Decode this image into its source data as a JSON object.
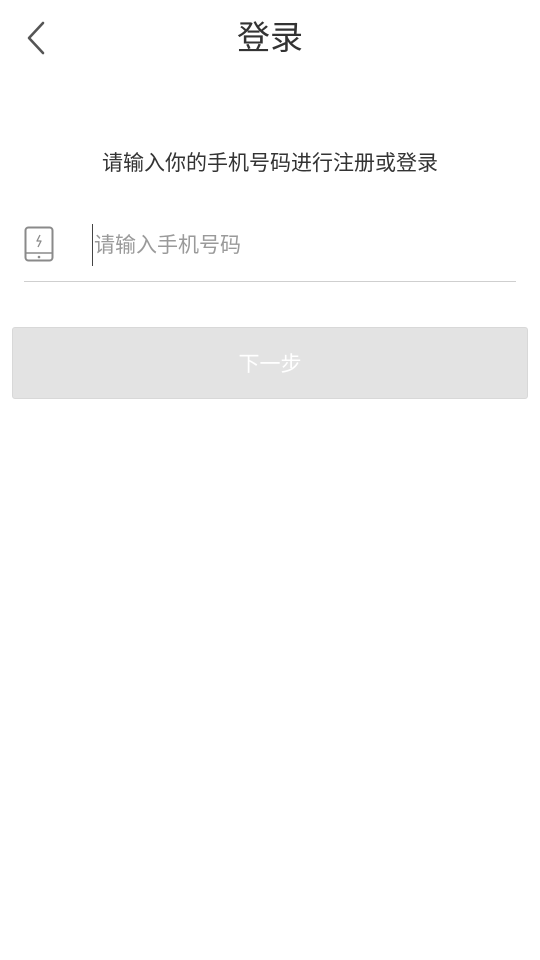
{
  "header": {
    "title": "登录",
    "back_icon": "chevron-left-icon"
  },
  "instruction": "请输入你的手机号码进行注册或登录",
  "phone_field": {
    "icon": "mobile-phone-icon",
    "value": "",
    "placeholder": "请输入手机号码"
  },
  "next_button": {
    "label": "下一步",
    "state": "disabled"
  },
  "colors": {
    "title_text": "#333333",
    "placeholder_text": "#9a9a9a",
    "button_disabled_bg": "#e3e3e3",
    "button_text": "#ffffff",
    "divider": "#cfcfcf"
  }
}
